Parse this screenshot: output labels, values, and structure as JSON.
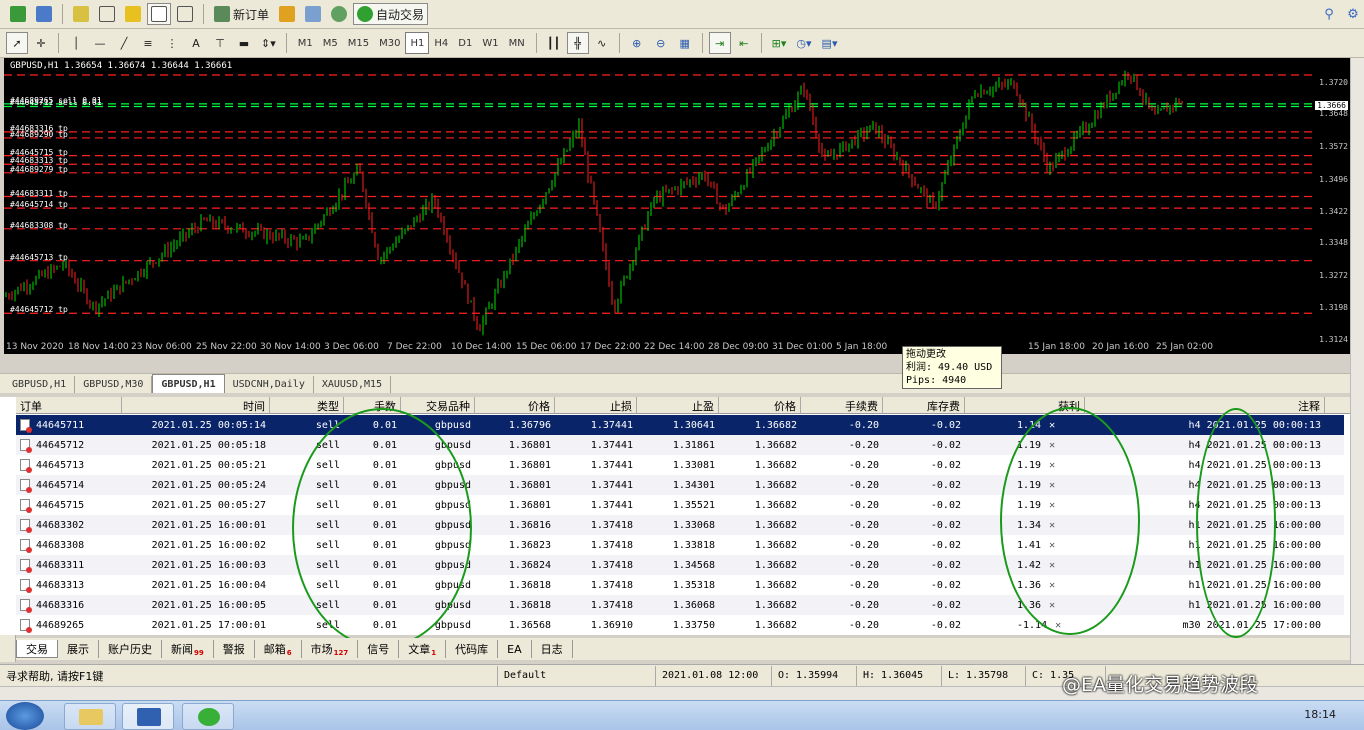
{
  "toolbar": {
    "new_order_label": "新订单",
    "auto_trade_label": "自动交易",
    "timeframes": [
      "M1",
      "M5",
      "M15",
      "M30",
      "H1",
      "H4",
      "D1",
      "W1",
      "MN"
    ],
    "active_timeframe": "H1"
  },
  "chart": {
    "symbol_info": "GBPUSD,H1  1.36654 1.36674 1.36644 1.36661",
    "order_labels": [
      {
        "text": "#44689265 sell 0.01",
        "level": 1.3672
      },
      {
        "text": "#44645711 sell 0.01",
        "level": 1.3666
      },
      {
        "text": "#44683316 tp",
        "level": 1.3607
      },
      {
        "text": "#44689290 tp",
        "level": 1.3593
      },
      {
        "text": "#44645715 tp",
        "level": 1.3552
      },
      {
        "text": "#44683313 tp",
        "level": 1.3532
      },
      {
        "text": "#44689279 tp",
        "level": 1.3512
      },
      {
        "text": "#44683311 tp",
        "level": 1.3457
      },
      {
        "text": "#44645714 tp",
        "level": 1.343
      },
      {
        "text": "#44683308 tp",
        "level": 1.3382
      },
      {
        "text": "#44645713 tp",
        "level": 1.3308
      },
      {
        "text": "#44645712 tp",
        "level": 1.3186
      }
    ],
    "price_labels": [
      "1.3720",
      "1.3666",
      "1.3648",
      "1.3572",
      "1.3496",
      "1.3422",
      "1.3348",
      "1.3272",
      "1.3198",
      "1.3124"
    ],
    "current_price": "1.3666",
    "time_labels": [
      "13 Nov 2020",
      "18 Nov 14:00",
      "23 Nov 06:00",
      "25 Nov 22:00",
      "30 Nov 14:00",
      "3 Dec 06:00",
      "7 Dec 22:00",
      "10 Dec 14:00",
      "15 Dec 06:00",
      "17 Dec 22:00",
      "22 Dec 14:00",
      "28 Dec 09:00",
      "31 Dec 01:00",
      "5 Jan 18:00",
      "",
      "15 Jan 18:00",
      "20 Jan 16:00",
      "25 Jan 02:00"
    ],
    "tooltip": {
      "title": "拖动更改",
      "profit": "利润:  49.40 USD",
      "pips": "Pips: 4940"
    }
  },
  "chart_tabs": [
    "GBPUSD,H1",
    "GBPUSD,M30",
    "GBPUSD,H1",
    "USDCNH,Daily",
    "XAUUSD,M15"
  ],
  "active_chart_tab": 2,
  "terminal": {
    "columns": [
      "订单",
      "时间",
      "类型",
      "手数",
      "交易品种",
      "价格",
      "止损",
      "止盈",
      "价格",
      "手续费",
      "库存费",
      "获利",
      "注释"
    ],
    "rows": [
      {
        "order": "44645711",
        "time": "2021.01.25 00:05:14",
        "type": "sell",
        "lots": "0.01",
        "symbol": "gbpusd",
        "price": "1.36796",
        "sl": "1.37441",
        "tp": "1.30641",
        "cur": "1.36682",
        "comm": "-0.20",
        "swap": "-0.02",
        "profit": "1.14",
        "comment": "h4 2021.01.25 00:00:13"
      },
      {
        "order": "44645712",
        "time": "2021.01.25 00:05:18",
        "type": "sell",
        "lots": "0.01",
        "symbol": "gbpusd",
        "price": "1.36801",
        "sl": "1.37441",
        "tp": "1.31861",
        "cur": "1.36682",
        "comm": "-0.20",
        "swap": "-0.02",
        "profit": "1.19",
        "comment": "h4 2021.01.25 00:00:13"
      },
      {
        "order": "44645713",
        "time": "2021.01.25 00:05:21",
        "type": "sell",
        "lots": "0.01",
        "symbol": "gbpusd",
        "price": "1.36801",
        "sl": "1.37441",
        "tp": "1.33081",
        "cur": "1.36682",
        "comm": "-0.20",
        "swap": "-0.02",
        "profit": "1.19",
        "comment": "h4 2021.01.25 00:00:13"
      },
      {
        "order": "44645714",
        "time": "2021.01.25 00:05:24",
        "type": "sell",
        "lots": "0.01",
        "symbol": "gbpusd",
        "price": "1.36801",
        "sl": "1.37441",
        "tp": "1.34301",
        "cur": "1.36682",
        "comm": "-0.20",
        "swap": "-0.02",
        "profit": "1.19",
        "comment": "h4 2021.01.25 00:00:13"
      },
      {
        "order": "44645715",
        "time": "2021.01.25 00:05:27",
        "type": "sell",
        "lots": "0.01",
        "symbol": "gbpusd",
        "price": "1.36801",
        "sl": "1.37441",
        "tp": "1.35521",
        "cur": "1.36682",
        "comm": "-0.20",
        "swap": "-0.02",
        "profit": "1.19",
        "comment": "h4 2021.01.25 00:00:13"
      },
      {
        "order": "44683302",
        "time": "2021.01.25 16:00:01",
        "type": "sell",
        "lots": "0.01",
        "symbol": "gbpusd",
        "price": "1.36816",
        "sl": "1.37418",
        "tp": "1.33068",
        "cur": "1.36682",
        "comm": "-0.20",
        "swap": "-0.02",
        "profit": "1.34",
        "comment": "h1 2021.01.25 16:00:00"
      },
      {
        "order": "44683308",
        "time": "2021.01.25 16:00:02",
        "type": "sell",
        "lots": "0.01",
        "symbol": "gbpusd",
        "price": "1.36823",
        "sl": "1.37418",
        "tp": "1.33818",
        "cur": "1.36682",
        "comm": "-0.20",
        "swap": "-0.02",
        "profit": "1.41",
        "comment": "h1 2021.01.25 16:00:00"
      },
      {
        "order": "44683311",
        "time": "2021.01.25 16:00:03",
        "type": "sell",
        "lots": "0.01",
        "symbol": "gbpusd",
        "price": "1.36824",
        "sl": "1.37418",
        "tp": "1.34568",
        "cur": "1.36682",
        "comm": "-0.20",
        "swap": "-0.02",
        "profit": "1.42",
        "comment": "h1 2021.01.25 16:00:00"
      },
      {
        "order": "44683313",
        "time": "2021.01.25 16:00:04",
        "type": "sell",
        "lots": "0.01",
        "symbol": "gbpusd",
        "price": "1.36818",
        "sl": "1.37418",
        "tp": "1.35318",
        "cur": "1.36682",
        "comm": "-0.20",
        "swap": "-0.02",
        "profit": "1.36",
        "comment": "h1 2021.01.25 16:00:00"
      },
      {
        "order": "44683316",
        "time": "2021.01.25 16:00:05",
        "type": "sell",
        "lots": "0.01",
        "symbol": "gbpusd",
        "price": "1.36818",
        "sl": "1.37418",
        "tp": "1.36068",
        "cur": "1.36682",
        "comm": "-0.20",
        "swap": "-0.02",
        "profit": "1.36",
        "comment": "h1 2021.01.25 16:00:00"
      },
      {
        "order": "44689265",
        "time": "2021.01.25 17:00:01",
        "type": "sell",
        "lots": "0.01",
        "symbol": "gbpusd",
        "price": "1.36568",
        "sl": "1.36910",
        "tp": "1.33750",
        "cur": "1.36682",
        "comm": "-0.20",
        "swap": "-0.02",
        "profit": "-1.14",
        "comment": "m30 2021.01.25 17:00:00"
      }
    ],
    "selected_row": 0,
    "tabs": [
      {
        "label": "交易",
        "badge": ""
      },
      {
        "label": "展示",
        "badge": ""
      },
      {
        "label": "账户历史",
        "badge": ""
      },
      {
        "label": "新闻",
        "badge": "99"
      },
      {
        "label": "警报",
        "badge": ""
      },
      {
        "label": "邮箱",
        "badge": "6"
      },
      {
        "label": "市场",
        "badge": "127"
      },
      {
        "label": "信号",
        "badge": ""
      },
      {
        "label": "文章",
        "badge": "1"
      },
      {
        "label": "代码库",
        "badge": ""
      },
      {
        "label": "EA",
        "badge": ""
      },
      {
        "label": "日志",
        "badge": ""
      }
    ],
    "active_tab": 0
  },
  "status": {
    "help": "寻求帮助, 请按F1键",
    "profile": "Default",
    "datetime": "2021.01.08 12:00",
    "open": "O: 1.35994",
    "high": "H: 1.36045",
    "low": "L: 1.35798",
    "close": "C: 1.35"
  },
  "watermark": "@EA量化交易趋势波段",
  "clock": "18:14",
  "colors": {
    "sl_line": "#ff2020",
    "tp_line": "#ff2020",
    "entry_line": "#00ff40",
    "bull": "#00e000",
    "bear": "#ff2020",
    "highlight": "#1a9a1a"
  }
}
